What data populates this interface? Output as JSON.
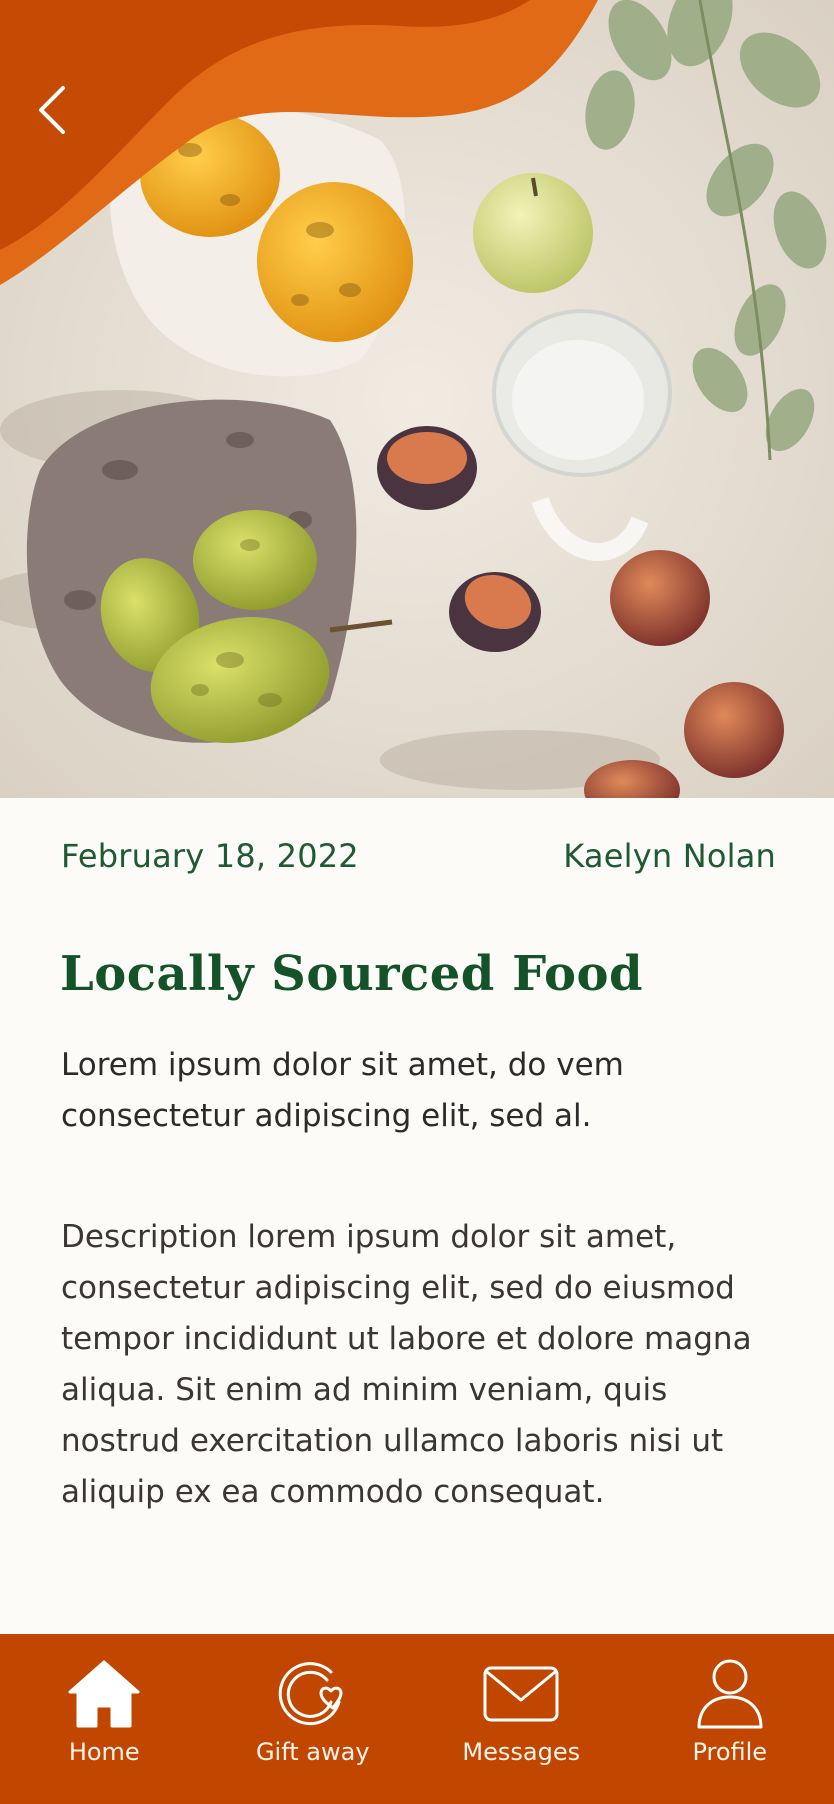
{
  "header": {
    "back_icon": "chevron-left-icon",
    "hero_image": "fruit-picnic-photo",
    "accent_color": "#d95b10",
    "accent_dark": "#c14700"
  },
  "article": {
    "date": "February 18, 2022",
    "author": "Kaelyn Nolan",
    "title": "Locally Sourced Food",
    "subtitle": "Lorem ipsum dolor sit amet, do vem consectetur adipiscing elit, sed al.",
    "description": "Description lorem ipsum dolor sit amet, consectetur adipiscing elit, sed do eiusmod tempor incididunt ut labore et dolore magna aliqua. Sit enim ad minim veniam, quis nostrud exercitation ullamco laboris nisi ut aliquip ex ea commodo consequat."
  },
  "nav": {
    "items": [
      {
        "label": "Home",
        "icon": "home-icon",
        "active": true
      },
      {
        "label": "Gift away",
        "icon": "gift-heart-icon",
        "active": false
      },
      {
        "label": "Messages",
        "icon": "mail-icon",
        "active": false
      },
      {
        "label": "Profile",
        "icon": "profile-icon",
        "active": false
      }
    ]
  }
}
